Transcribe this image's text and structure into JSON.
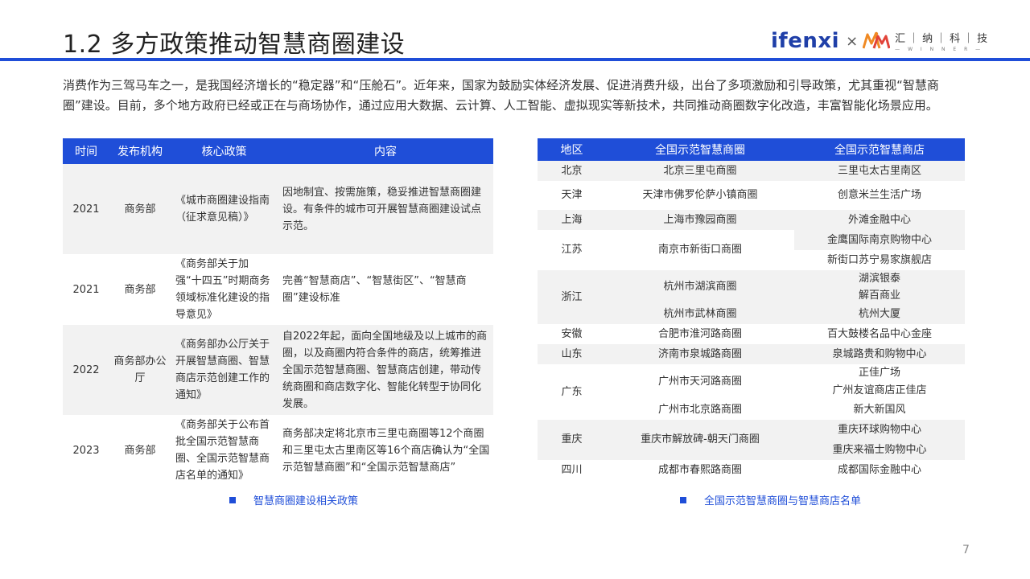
{
  "header": {
    "title": "1.2 多方政策推动智慧商圈建设",
    "logo": {
      "brand": "ifenxi",
      "cross": "×",
      "partner_cn": "汇｜纳｜科｜技",
      "partner_en": "— W I N N E R —",
      "accent": "#1f3fa8",
      "partner_color": "#f08a24"
    }
  },
  "intro": "消费作为三驾马车之一，是我国经济增长的“稳定器”和“压舱石”。近年来，国家为鼓励实体经济发展、促进消费升级，出台了多项激励和引导政策，尤其重视“智慧商圈”建设。目前，多个地方政府已经或正在与商场协作，通过应用大数据、云计算、人工智能、虚拟现实等新技术，共同推动商圈数字化改造，丰富智能化场景应用。",
  "policy_table": {
    "headers": [
      "时间",
      "发布机构",
      "核心政策",
      "内容"
    ],
    "rows": [
      {
        "year": "2021",
        "org": "商务部",
        "policy": "《城市商圈建设指南（征求意见稿）》",
        "content": "因地制宜、按需施策，稳妥推进智慧商圈建设。有条件的城市可开展智慧商圈建设试点示范。"
      },
      {
        "year": "2021",
        "org": "商务部",
        "policy": "《商务部关于加强“十四五”时期商务领域标准化建设的指导意见》",
        "content": "完善“智慧商店”、“智慧街区”、“智慧商圈”建设标准"
      },
      {
        "year": "2022",
        "org": "商务部办公厅",
        "policy": "《商务部办公厅关于开展智慧商圈、智慧商店示范创建工作的通知》",
        "content": "自2022年起，面向全国地级及以上城市的商圈，以及商圈内符合条件的商店，统筹推进全国示范智慧商圈、智慧商店创建，带动传统商圈和商店数字化、智能化转型于协同化发展。"
      },
      {
        "year": "2023",
        "org": "商务部",
        "policy": "《商务部关于公布首批全国示范智慧商圈、全国示范智慧商店名单的通知》",
        "content": "商务部决定将北京市三里屯商圈等12个商圈和三里屯太古里南区等16个商店确认为“全国示范智慧商圈”和“全国示范智慧商店”"
      }
    ],
    "caption": "智慧商圈建设相关政策"
  },
  "district_table": {
    "headers": [
      "地区",
      "全国示范智慧商圈",
      "全国示范智慧商店"
    ],
    "rows": {
      "beijing": {
        "region": "北京",
        "district": "北京三里屯商圈",
        "store": "三里屯太古里南区"
      },
      "tianjin": {
        "region": "天津",
        "district": "天津市佛罗伦萨小镇商圈",
        "store": "创意米兰生活广场"
      },
      "shanghai": {
        "region": "上海",
        "district": "上海市豫园商圈",
        "store": "外滩金融中心"
      },
      "jiangsu": {
        "region": "江苏",
        "district": "南京市新街口商圈",
        "store_1": "金鹰国际南京购物中心",
        "store_2": "新街口苏宁易家旗舰店"
      },
      "zhejiang": {
        "region": "浙江",
        "district_1": "杭州市湖滨商圈",
        "store_1a": "湖滨银泰",
        "store_1b": "解百商业",
        "district_2": "杭州市武林商圈",
        "store_2": "杭州大厦"
      },
      "anhui": {
        "region": "安徽",
        "district": "合肥市淮河路商圈",
        "store": "百大鼓楼名品中心金座"
      },
      "shandong": {
        "region": "山东",
        "district": "济南市泉城路商圈",
        "store": "泉城路贵和购物中心"
      },
      "guangdong": {
        "region": "广东",
        "district_1": "广州市天河路商圈",
        "store_1a": "正佳广场",
        "store_1b": "广州友谊商店正佳店",
        "district_2": "广州市北京路商圈",
        "store_2": "新大新国风"
      },
      "chongqing": {
        "region": "重庆",
        "district": "重庆市解放碑-朝天门商圈",
        "store_1": "重庆环球购物中心",
        "store_2": "重庆来福士购物中心"
      },
      "sichuan": {
        "region": "四川",
        "district": "成都市春熙路商圈",
        "store": "成都国际金融中心"
      }
    },
    "caption": "全国示范智慧商圈与智慧商店名单"
  },
  "page_number": "7"
}
